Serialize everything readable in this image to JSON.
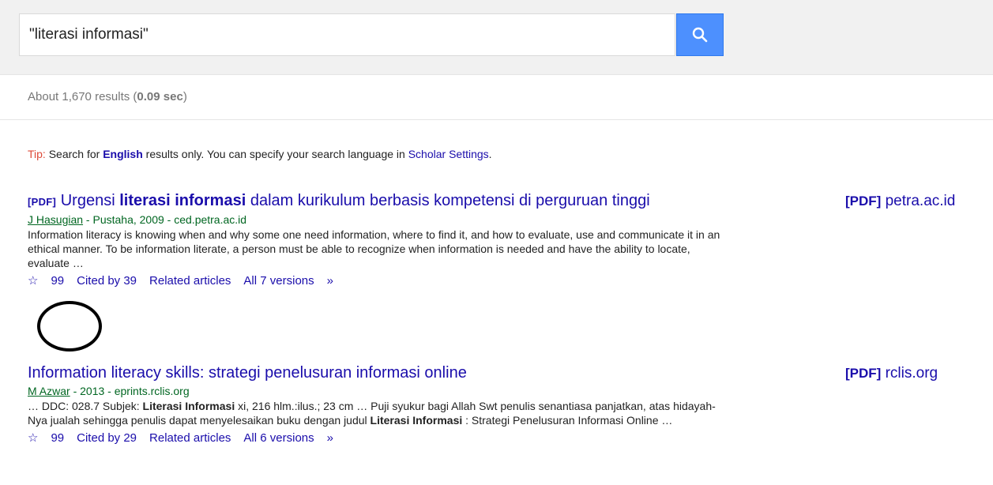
{
  "search": {
    "query": "\"literasi informasi\""
  },
  "stats": {
    "prefix": "About 1,670 results (",
    "time": "0.09 sec",
    "suffix": ")"
  },
  "tip": {
    "label": "Tip:",
    "text_before": " Search for ",
    "english": "English",
    "text_middle": " results only. You can specify your search language in ",
    "settings_link": "Scholar Settings",
    "text_after": "."
  },
  "results": [
    {
      "pdf_tag": "[PDF]",
      "title_before": " Urgensi ",
      "title_bold": "literasi informasi",
      "title_after": " dalam kurikulum berbasis kompetensi di perguruan tinggi",
      "author": "J Hasugian",
      "meta_rest": " - Pustaha, 2009 - ced.petra.ac.id",
      "snippet": "Information literacy is knowing when and why some one need information, where to find it, and how to evaluate, use and communicate it in an ethical manner. To be information literate, a person must be able to recognize when information is needed and have the ability to locate, evaluate …",
      "cited_by": "Cited by 39",
      "related": "Related articles",
      "versions": "All 7 versions",
      "side_tag": "[PDF]",
      "side_domain": " petra.ac.id"
    },
    {
      "title": "Information literacy skills: strategi penelusuran informasi online",
      "author": "M Azwar",
      "meta_rest": " - 2013 - eprints.rclis.org",
      "snippet_1": "… DDC: 028.7 Subjek: ",
      "snippet_b1": "Literasi Informasi",
      "snippet_2": " xi, 216 hlm.:ilus.; 23 cm … Puji syukur bagi Allah Swt penulis senantiasa panjatkan, atas hidayah-Nya jualah sehingga penulis dapat menyelesaikan buku dengan judul ",
      "snippet_b2": "Literasi Informasi",
      "snippet_3": " : Strategi Penelusuran Informasi Online …",
      "cited_by": "Cited by 29",
      "related": "Related articles",
      "versions": "All 6 versions",
      "side_tag": "[PDF]",
      "side_domain": " rclis.org"
    }
  ],
  "icons": {
    "star": "☆",
    "cite": "99",
    "more": "»"
  },
  "colors": {
    "link": "#1a0dab",
    "green": "#006621",
    "search_button": "#4d90fe",
    "tip_label": "#dd4b39"
  }
}
